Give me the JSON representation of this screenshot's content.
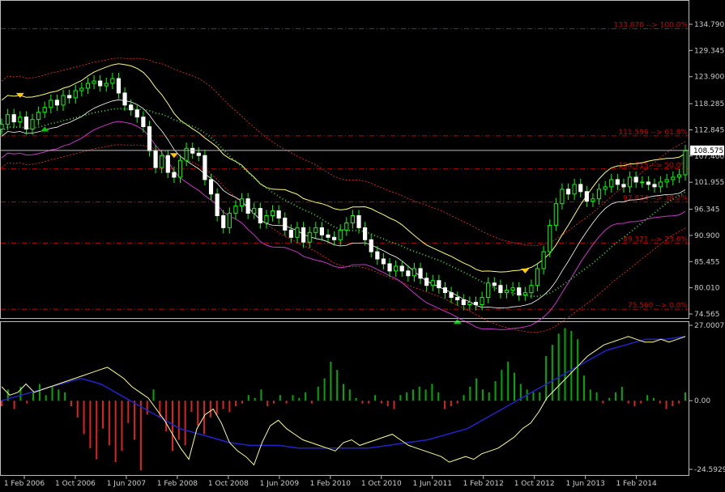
{
  "chart_data": [
    {
      "type": "candlestick",
      "panel": "main",
      "ylim": [
        74.565,
        134.79
      ],
      "y_ticks": [
        "134.790",
        "129.345",
        "123.900",
        "118.285",
        "112.845",
        "107.400",
        "101.955",
        "96.345",
        "90.900",
        "85.455",
        "80.010",
        "74.565"
      ],
      "current_price": {
        "value": 108.575,
        "label": "108.575"
      },
      "fibonacci_levels": [
        {
          "value": 133.87,
          "label": "133.870 --> 100.0%"
        },
        {
          "value": 111.596,
          "label": "111.596 --> 61.8%"
        },
        {
          "value": 104.715,
          "label": "104.715 --> 50.0%"
        },
        {
          "value": 97.834,
          "label": "97.834 --> 38.2%"
        },
        {
          "value": 89.321,
          "label": "89.321 --> 23.6%"
        },
        {
          "value": 75.56,
          "label": "75.560 --> 0.0%"
        }
      ],
      "colors": {
        "bull": "#00ff00",
        "bear": "#ffffff",
        "fib": "#cc0000",
        "envelope": "#ffff66",
        "band_outer": "#cc2222",
        "magenta": "#cc33cc",
        "signal_trail": "#ffcc33",
        "green_trail": "#33cc33",
        "arrow_sell": "#ffcc00",
        "arrow_buy": "#00cc00"
      }
    },
    {
      "type": "histogram",
      "panel": "oscillator",
      "ylim": [
        -24.5929,
        27.0007
      ],
      "y_ticks": [
        "27.0007",
        "0.00",
        "-24.5929"
      ],
      "colors": {
        "up": "#00aa00",
        "down": "#dd2222",
        "fast": "#ffff88",
        "slow": "#2222cc"
      }
    }
  ],
  "x_ticks": [
    "1 Feb 2006",
    "1 Oct 2006",
    "1 Jun 2007",
    "1 Feb 2008",
    "1 Oct 2008",
    "1 Jun 2009",
    "1 Feb 2010",
    "1 Oct 2010",
    "1 Jun 2011",
    "1 Feb 2012",
    "1 Oct 2012",
    "1 Jun 2013",
    "1 Feb 2014"
  ],
  "series": {
    "close": [
      114.0,
      116.0,
      114.5,
      115.5,
      113.0,
      115.0,
      116.5,
      117.5,
      119.0,
      118.0,
      120.0,
      119.5,
      121.0,
      121.5,
      122.5,
      123.0,
      122.0,
      122.5,
      123.5,
      120.5,
      118.0,
      117.0,
      115.5,
      113.5,
      108.5,
      105.0,
      107.5,
      104.0,
      103.0,
      106.5,
      109.0,
      108.0,
      107.5,
      102.5,
      99.5,
      95.0,
      92.5,
      95.5,
      97.0,
      98.5,
      95.5,
      96.5,
      93.5,
      95.0,
      96.0,
      94.5,
      92.0,
      90.5,
      92.5,
      89.5,
      91.5,
      92.5,
      91.0,
      90.5,
      90.0,
      92.0,
      93.5,
      95.0,
      92.5,
      90.0,
      87.5,
      86.0,
      85.0,
      83.5,
      84.5,
      83.5,
      82.5,
      84.0,
      82.0,
      80.5,
      81.5,
      80.0,
      79.0,
      78.0,
      77.5,
      76.5,
      77.0,
      76.5,
      78.0,
      81.0,
      80.5,
      79.0,
      79.5,
      80.0,
      78.5,
      79.0,
      80.5,
      84.0,
      87.5,
      93.0,
      97.5,
      100.5,
      99.5,
      101.5,
      100.0,
      98.0,
      98.5,
      100.5,
      101.0,
      102.5,
      101.5,
      101.0,
      103.0,
      102.0,
      102.0,
      101.5,
      101.0,
      102.0,
      102.5,
      103.0,
      103.5,
      108.5
    ],
    "hist": [
      -2,
      4,
      -3,
      5,
      -1,
      3,
      6,
      2,
      5,
      4,
      3,
      -2,
      -6,
      -12,
      -17,
      -21,
      -10,
      -16,
      -22,
      -18,
      -8,
      -14,
      -25,
      -5,
      4,
      -6,
      -11,
      -18,
      -14,
      -16,
      -4,
      -9,
      -12,
      -6,
      -5,
      -3,
      -4,
      -2,
      -1,
      2,
      1,
      4,
      -2,
      -1,
      2,
      -1,
      2,
      1,
      3,
      -1,
      5,
      8,
      14,
      11,
      6,
      4,
      1,
      -1,
      -1,
      2,
      -1,
      -2,
      -3,
      2,
      3,
      4,
      5,
      4,
      6,
      3,
      -3,
      -2,
      -1,
      2,
      5,
      8,
      4,
      3,
      7,
      11,
      14,
      10,
      6,
      4,
      3,
      3,
      16,
      20,
      24,
      26,
      25,
      22,
      9,
      4,
      3,
      -1,
      1,
      3,
      5,
      -1,
      -2,
      -1,
      2,
      1,
      -1,
      -3,
      -2,
      -1,
      3
    ],
    "fast": [
      5,
      2,
      3,
      6,
      3,
      4,
      5,
      6,
      7,
      8,
      9,
      10,
      11,
      12,
      10,
      8,
      5,
      3,
      1,
      -3,
      -7,
      -12,
      -17,
      -21,
      -10,
      -5,
      -3,
      -8,
      -15,
      -18,
      -20,
      -23,
      -15,
      -9,
      -7,
      -10,
      -12,
      -14,
      -15,
      -16,
      -17,
      -18,
      -15,
      -14,
      -16,
      -15,
      -14,
      -13,
      -12,
      -14,
      -16,
      -17,
      -18,
      -19,
      -20,
      -22,
      -21,
      -20,
      -21,
      -19,
      -18,
      -17,
      -15,
      -13,
      -10,
      -8,
      -4,
      1,
      4,
      7,
      10,
      13,
      16,
      18,
      20,
      21,
      22,
      23,
      22,
      21,
      21,
      22,
      21,
      22,
      23
    ],
    "slow": [
      0,
      1,
      2,
      3,
      4,
      5,
      6,
      7,
      8,
      7,
      6,
      4,
      2,
      0,
      -2,
      -4,
      -6,
      -8,
      -10,
      -11,
      -12,
      -13,
      -14,
      -15,
      -15.5,
      -16,
      -16,
      -16,
      -16,
      -16.5,
      -17,
      -17,
      -17,
      -17,
      -17,
      -17,
      -17,
      -17,
      -16.5,
      -16,
      -15.5,
      -15,
      -14.5,
      -14,
      -13,
      -12,
      -11,
      -10,
      -8,
      -6,
      -4,
      -2,
      0,
      2,
      4,
      6,
      8,
      10,
      12,
      14,
      16,
      18,
      19,
      20,
      21,
      22,
      22,
      22,
      22.5,
      23
    ]
  }
}
